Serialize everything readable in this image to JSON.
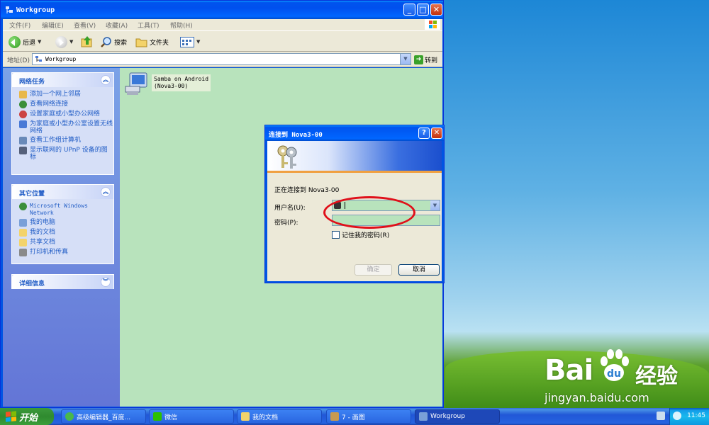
{
  "window": {
    "title": "Workgroup",
    "buttons": {
      "minimize": "_",
      "maximize": "□",
      "close": "✕"
    }
  },
  "menu": [
    "文件(F)",
    "编辑(E)",
    "查看(V)",
    "收藏(A)",
    "工具(T)",
    "帮助(H)"
  ],
  "toolbar": {
    "back": "后退",
    "search": "搜索",
    "folders": "文件夹"
  },
  "address": {
    "label": "地址(D)",
    "value": "Workgroup",
    "go": "转到"
  },
  "sidebar": {
    "network_tasks": {
      "title": "网络任务",
      "items": [
        "添加一个网上邻居",
        "查看网络连接",
        "设置家庭或小型办公网络",
        "为家庭或小型办公室设置无线网络",
        "查看工作组计算机",
        "显示联网的 UPnP 设备的图标"
      ]
    },
    "other_places": {
      "title": "其它位置",
      "items": [
        "Microsoft Windows Network",
        "我的电脑",
        "我的文档",
        "共享文档",
        "打印机和传真"
      ]
    },
    "details": {
      "title": "详细信息"
    }
  },
  "content": {
    "item_name": "Samba on Android",
    "item_sub": "(Nova3-00)"
  },
  "dialog": {
    "title": "连接到 Nova3-00",
    "help": "?",
    "close": "✕",
    "connecting": "正在连接到 Nova3-00",
    "username_label": "用户名(U):",
    "password_label": "密码(P):",
    "remember": "记住我的密码(R)",
    "ok": "确定",
    "cancel": "取消"
  },
  "taskbar": {
    "start": "开始",
    "tasks": [
      "高级编辑器_百度...",
      "微信",
      "我的文档",
      "7 - 画图",
      "Workgroup"
    ],
    "clock": "11:45"
  },
  "watermark": {
    "logo": "Bai",
    "cn": "经验",
    "url": "jingyan.baidu.com"
  },
  "colors": {
    "xp_blue": "#0054e3",
    "sidebar": "#6375d6",
    "content_bg": "#b8e3bc",
    "highlight_circle": "#e0101a",
    "start_green": "#3c9a3c"
  }
}
